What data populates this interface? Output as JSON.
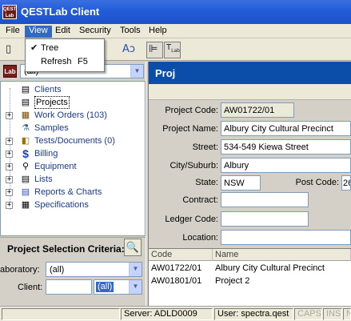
{
  "window": {
    "title": "QESTLab Client",
    "icon_text": "QEST Lab"
  },
  "menu": {
    "items": [
      {
        "label": "File"
      },
      {
        "label": "View"
      },
      {
        "label": "Edit"
      },
      {
        "label": "Security"
      },
      {
        "label": "Tools"
      },
      {
        "label": "Help"
      }
    ],
    "view_dropdown": [
      {
        "label": "Tree",
        "checked": true,
        "shortcut": ""
      },
      {
        "label": "Refresh",
        "checked": false,
        "shortcut": "F5"
      }
    ]
  },
  "toolbar": {
    "buttons": [
      {
        "name": "new-icon"
      },
      {
        "name": "print-icon"
      },
      {
        "name": "spell-check-icon"
      },
      {
        "name": "tree-view-icon",
        "pressed": true
      },
      {
        "name": "lab-tree-icon",
        "pressed": true
      }
    ]
  },
  "sidebar": {
    "lab_icon_text": "Lab",
    "lab_select_value": "(all)",
    "tree_items": [
      {
        "label": "Clients",
        "icon": "clients-icon",
        "glyph": "▤",
        "expandable": false,
        "selected": false
      },
      {
        "label": "Projects",
        "icon": "projects-icon",
        "glyph": "▤",
        "expandable": false,
        "selected": true
      },
      {
        "label": "Work Orders (103)",
        "icon": "work-orders-icon",
        "glyph": "▦",
        "expandable": true,
        "selected": false
      },
      {
        "label": "Samples",
        "icon": "samples-icon",
        "glyph": "⚗",
        "expandable": false,
        "selected": false
      },
      {
        "label": "Tests/Documents (0)",
        "icon": "tests-documents-icon",
        "glyph": "◧",
        "expandable": true,
        "selected": false
      },
      {
        "label": "Billing",
        "icon": "billing-icon",
        "glyph": "$",
        "expandable": true,
        "selected": false
      },
      {
        "label": "Equipment",
        "icon": "equipment-icon",
        "glyph": "⚲",
        "expandable": true,
        "selected": false
      },
      {
        "label": "Lists",
        "icon": "lists-icon",
        "glyph": "▤",
        "expandable": true,
        "selected": false
      },
      {
        "label": "Reports & Charts",
        "icon": "reports-charts-icon",
        "glyph": "▤",
        "expandable": true,
        "selected": false
      },
      {
        "label": "Specifications",
        "icon": "specifications-icon",
        "glyph": "▦",
        "expandable": true,
        "selected": false
      }
    ],
    "criteria": {
      "title": "Project Selection Criteria:",
      "laboratory_label": "aboratory:",
      "laboratory_value": "(all)",
      "client_label": "Client:",
      "client_value": "",
      "client_select_value": "(all)"
    }
  },
  "main": {
    "header_title": "Proj",
    "form": {
      "project_code_label": "Project Code:",
      "project_code_value": "AW01722/01",
      "project_name_label": "Project Name:",
      "project_name_value": "Albury City Cultural Precinct",
      "street_label": "Street:",
      "street_value": "534-549 Kiewa Street",
      "city_label": "City/Suburb:",
      "city_value": "Albury",
      "state_label": "State:",
      "state_value": "NSW",
      "postcode_label": "Post Code:",
      "postcode_value": "26",
      "contract_label": "Contract:",
      "contract_value": "",
      "ledger_label": "Ledger Code:",
      "ledger_value": "",
      "location_label": "Location:",
      "location_value": ""
    },
    "grid": {
      "columns": [
        "Code",
        "Name"
      ],
      "rows": [
        {
          "code": "AW01722/01",
          "name": "Albury City Cultural Precinct"
        },
        {
          "code": "AW01801/01",
          "name": "Project 2"
        },
        {
          "code": "",
          "name": ""
        }
      ]
    }
  },
  "statusbar": {
    "server": "Server: ADLD0009",
    "user": "User: spectra.qest",
    "caps": "CAPS",
    "ins": "INS",
    "num": "NU"
  }
}
